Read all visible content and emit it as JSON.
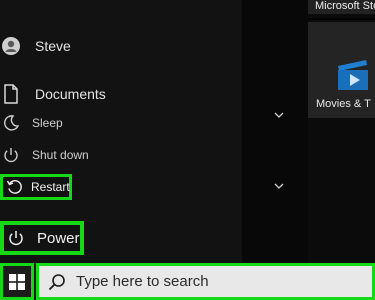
{
  "start_menu": {
    "user": {
      "name": "Steve",
      "icon": "user-avatar-icon"
    },
    "documents": {
      "label": "Documents",
      "icon": "document-icon"
    },
    "power_options": [
      {
        "label": "Sleep",
        "icon": "moon-icon"
      },
      {
        "label": "Shut down",
        "icon": "power-icon"
      },
      {
        "label": "Restart",
        "icon": "restart-icon",
        "highlighted": true
      }
    ],
    "power_button": {
      "label": "Power",
      "icon": "power-icon",
      "highlighted": true
    }
  },
  "tiles": {
    "top_tile_label": "Microsoft Store",
    "movies_tile_label": "Movies & T"
  },
  "taskbar": {
    "start_icon": "windows-logo-icon",
    "search": {
      "placeholder": "Type here to search",
      "value": "",
      "icon": "search-icon"
    }
  },
  "colors": {
    "highlight": "#16d916",
    "menu_bg": "#121212",
    "taskbar_bg": "#1c1c1c"
  }
}
